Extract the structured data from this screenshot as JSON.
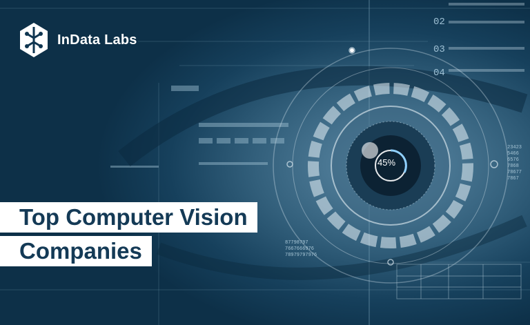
{
  "brand": {
    "name": "InData Labs",
    "logo_icon": "circuit-hexagon-icon"
  },
  "headline": {
    "line1": "Top Computer Vision",
    "line2": "Companies"
  },
  "hud": {
    "gauge_value": "45%",
    "step_numbers": [
      "02",
      "03",
      "04"
    ],
    "codes_left": [
      "87798797",
      "7667666976",
      "78979797976"
    ],
    "codes_right": [
      "23423",
      "5466",
      "6576",
      "7868",
      "78677",
      "7867"
    ]
  },
  "colors": {
    "background": "#0f3550",
    "headline_text": "#143a56",
    "headline_bg": "#ffffff",
    "hud_lines": "#cfe3ee"
  }
}
